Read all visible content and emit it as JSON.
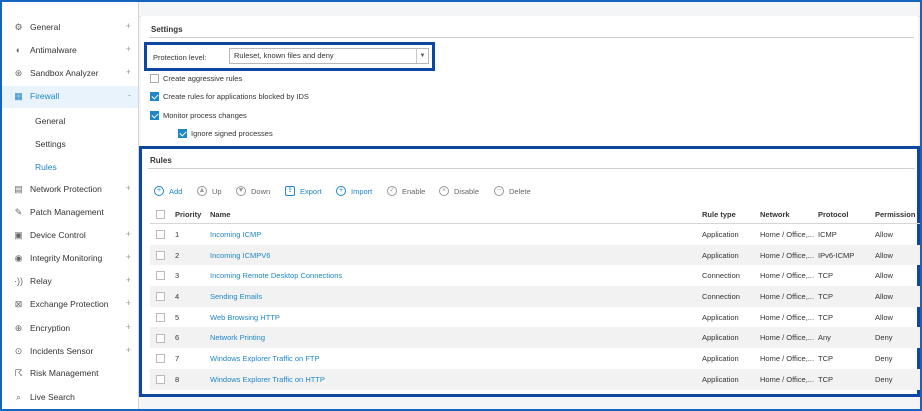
{
  "sidebar": {
    "items": [
      {
        "label": "General",
        "icon": "gear-icon",
        "glyph": "⚙",
        "expand": "+"
      },
      {
        "label": "Antimalware",
        "icon": "shield-icon",
        "glyph": "◐",
        "expand": "+"
      },
      {
        "label": "Sandbox Analyzer",
        "icon": "sandbox-icon",
        "glyph": "⊛",
        "expand": "+"
      },
      {
        "label": "Firewall",
        "icon": "firewall-icon",
        "glyph": "▦",
        "expand": "-"
      },
      {
        "label": "Network Protection",
        "icon": "network-icon",
        "glyph": "▤",
        "expand": "+"
      },
      {
        "label": "Patch Management",
        "icon": "patch-icon",
        "glyph": "✎",
        "expand": ""
      },
      {
        "label": "Device Control",
        "icon": "device-icon",
        "glyph": "▣",
        "expand": "+"
      },
      {
        "label": "Integrity Monitoring",
        "icon": "integrity-icon",
        "glyph": "◉",
        "expand": "+"
      },
      {
        "label": "Relay",
        "icon": "relay-icon",
        "glyph": "·))",
        "expand": "+"
      },
      {
        "label": "Exchange Protection",
        "icon": "exchange-icon",
        "glyph": "⊠",
        "expand": "+"
      },
      {
        "label": "Encryption",
        "icon": "lock-icon",
        "glyph": "⊕",
        "expand": "+"
      },
      {
        "label": "Incidents Sensor",
        "icon": "sensor-icon",
        "glyph": "⊙",
        "expand": "+"
      },
      {
        "label": "Risk Management",
        "icon": "risk-icon",
        "glyph": "☈",
        "expand": ""
      },
      {
        "label": "Live Search",
        "icon": "search-icon",
        "glyph": "⌕",
        "expand": ""
      }
    ],
    "firewall_sub": [
      "General",
      "Settings",
      "Rules"
    ]
  },
  "settings": {
    "title": "Settings",
    "protection_level_label": "Protection level:",
    "protection_level_value": "Ruleset, known files and deny",
    "options": [
      {
        "label": "Create aggressive rules",
        "checked": false
      },
      {
        "label": "Create rules for applications blocked by IDS",
        "checked": true
      },
      {
        "label": "Monitor process changes",
        "checked": true
      },
      {
        "label": "Ignore signed processes",
        "checked": true
      }
    ]
  },
  "rules": {
    "title": "Rules",
    "toolbar": [
      {
        "label": "Add",
        "icon": "add-icon",
        "glyph": "+"
      },
      {
        "label": "Up",
        "icon": "arrow-up-icon",
        "glyph": "▲"
      },
      {
        "label": "Down",
        "icon": "arrow-down-icon",
        "glyph": "▼"
      },
      {
        "label": "Export",
        "icon": "export-icon",
        "glyph": "⇪"
      },
      {
        "label": "Import",
        "icon": "import-icon",
        "glyph": "+"
      },
      {
        "label": "Enable",
        "icon": "check-icon",
        "glyph": "✓"
      },
      {
        "label": "Disable",
        "icon": "close-icon",
        "glyph": "×"
      },
      {
        "label": "Delete",
        "icon": "minus-icon",
        "glyph": "−"
      }
    ],
    "columns": [
      "Priority",
      "Name",
      "Rule type",
      "Network",
      "Protocol",
      "Permission"
    ],
    "rows": [
      {
        "priority": "1",
        "name": "Incoming ICMP",
        "type": "Application",
        "network": "Home / Office,...",
        "protocol": "ICMP",
        "permission": "Allow"
      },
      {
        "priority": "2",
        "name": "Incoming ICMPV6",
        "type": "Application",
        "network": "Home / Office,...",
        "protocol": "IPv6-ICMP",
        "permission": "Allow"
      },
      {
        "priority": "3",
        "name": "Incoming Remote Desktop Connections",
        "type": "Connection",
        "network": "Home / Office,...",
        "protocol": "TCP",
        "permission": "Allow"
      },
      {
        "priority": "4",
        "name": "Sending Emails",
        "type": "Connection",
        "network": "Home / Office,...",
        "protocol": "TCP",
        "permission": "Allow"
      },
      {
        "priority": "5",
        "name": "Web Browsing HTTP",
        "type": "Application",
        "network": "Home / Office,...",
        "protocol": "TCP",
        "permission": "Allow"
      },
      {
        "priority": "6",
        "name": "Network Printing",
        "type": "Application",
        "network": "Home / Office,...",
        "protocol": "Any",
        "permission": "Deny"
      },
      {
        "priority": "7",
        "name": "Windows Explorer Traffic on FTP",
        "type": "Application",
        "network": "Home / Office,...",
        "protocol": "TCP",
        "permission": "Deny"
      },
      {
        "priority": "8",
        "name": "Windows Explorer Traffic on HTTP",
        "type": "Application",
        "network": "Home / Office,...",
        "protocol": "TCP",
        "permission": "Deny"
      }
    ]
  },
  "colors": {
    "accent": "#1e87c8",
    "highlight_border": "#0d47a1",
    "frame_border": "#1565c0"
  }
}
